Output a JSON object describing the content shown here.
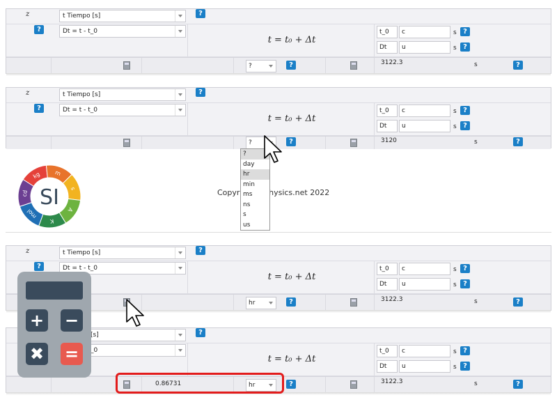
{
  "panels": [
    {
      "z_label": "z",
      "var_select": "t Tiempo [s]",
      "expr_select": "Dt = t - t_0",
      "formula": "t = t₀ + Δt",
      "vars": [
        {
          "name": "t_0",
          "value": "c",
          "unit": "s"
        },
        {
          "name": "Dt",
          "value": "u",
          "unit": "s"
        }
      ],
      "output_value": "",
      "unit_select": "?",
      "result_value": "3122.3",
      "result_unit": "s"
    },
    {
      "z_label": "z",
      "var_select": "t Tiempo [s]",
      "expr_select": "Dt = t - t_0",
      "formula": "t = t₀ + Δt",
      "vars": [
        {
          "name": "t_0",
          "value": "c",
          "unit": "s"
        },
        {
          "name": "Dt",
          "value": "u",
          "unit": "s"
        }
      ],
      "output_value": "",
      "unit_select": "?",
      "result_value": "3120",
      "result_unit": "s"
    },
    {
      "z_label": "z",
      "var_select": "t Tiempo [s]",
      "expr_select": "Dt = t - t_0",
      "formula": "t = t₀ + Δt",
      "vars": [
        {
          "name": "t_0",
          "value": "c",
          "unit": "s"
        },
        {
          "name": "Dt",
          "value": "u",
          "unit": "s"
        }
      ],
      "output_value": "",
      "unit_select": "hr",
      "result_value": "3122.3",
      "result_unit": "s"
    },
    {
      "z_label": "",
      "var_select": "[s]",
      "expr_select": "_0",
      "formula": "t = t₀ + Δt",
      "vars": [
        {
          "name": "t_0",
          "value": "c",
          "unit": "s"
        },
        {
          "name": "Dt",
          "value": "u",
          "unit": "s"
        }
      ],
      "output_value": "0.86731",
      "unit_select": "hr",
      "result_value": "3122.3",
      "result_unit": "s"
    }
  ],
  "unit_dropdown_options": [
    "?",
    "day",
    "hr",
    "min",
    "ms",
    "ns",
    "s",
    "us"
  ],
  "unit_dropdown_highlighted": "hr",
  "copyright": "Copyright SIPhysics.net 2022",
  "si_logo": {
    "center_text": "SI",
    "segments": [
      "kg",
      "m",
      "s",
      "A",
      "K",
      "mol",
      "cd"
    ]
  },
  "help_label": "?",
  "colors": {
    "help_blue": "#1a7fc7",
    "highlight_red": "#e21b1b"
  }
}
